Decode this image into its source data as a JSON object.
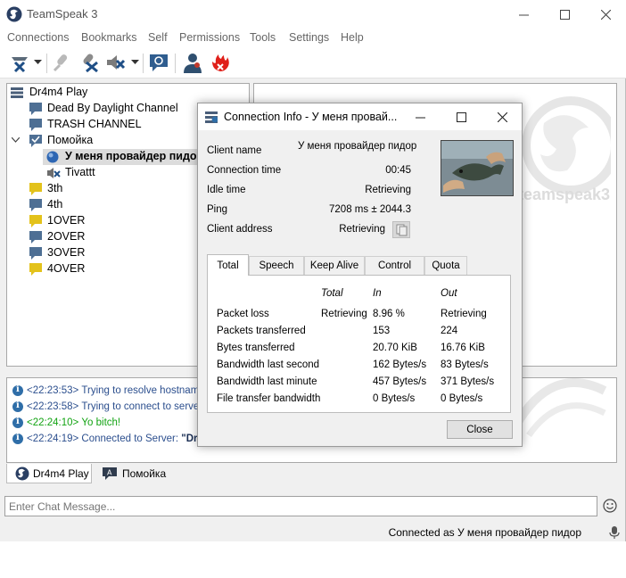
{
  "window": {
    "title": "TeamSpeak 3"
  },
  "menu": [
    "Connections",
    "Bookmarks",
    "Self",
    "Permissions",
    "Tools",
    "Settings",
    "Help"
  ],
  "toolbar_icons": [
    "disconnect-icon",
    "chevron-down-icon",
    "toggle-microphone-icon",
    "toggle-speakers-icon",
    "away-icon",
    "chevron-down-icon",
    "whisper-icon",
    "contacts-icon",
    "ban-icon"
  ],
  "tree": {
    "server": "Dr4m4 Play",
    "rows": [
      {
        "label": "Dead By Daylight Channel",
        "bold": false
      },
      {
        "label": "TRASH CHANNEL",
        "bold": false
      },
      {
        "label": "Помойка",
        "bold": false
      },
      {
        "label": "У меня провайдер пидор",
        "bold": true
      },
      {
        "label": "Tivattt",
        "bold": false
      },
      {
        "label": "3th",
        "bold": false
      },
      {
        "label": "4th",
        "bold": false
      },
      {
        "label": "1OVER",
        "bold": false
      },
      {
        "label": "2OVER",
        "bold": false
      },
      {
        "label": "3OVER",
        "bold": false
      },
      {
        "label": "4OVER",
        "bold": false
      }
    ]
  },
  "info_watermark": "teamspeak3",
  "log": [
    {
      "time": "<22:23:53>",
      "text": "Trying to resolve hostname",
      "color": "#2c4f8e"
    },
    {
      "time": "<22:23:58>",
      "text": "Trying to connect to server",
      "color": "#2c4f8e"
    },
    {
      "time": "<22:24:10>",
      "text": "Yo bitch!",
      "color": "#12a312"
    },
    {
      "time": "<22:24:19>",
      "text": "Connected to Server:",
      "extra": "\"Dr4",
      "color": "#2c4f8e"
    }
  ],
  "chat_tabs": [
    "Dr4m4 Play",
    "Помойка"
  ],
  "chat_input": {
    "placeholder": "Enter Chat Message..."
  },
  "status": {
    "text": "Connected as У меня провайдер пидор"
  },
  "dialog": {
    "title": "Connection Info - У меня провай...",
    "fields": [
      {
        "label": "Client name",
        "value": "У меня провайдер пидор"
      },
      {
        "label": "Connection time",
        "value": "00:45"
      },
      {
        "label": "Idle time",
        "value": "Retrieving"
      },
      {
        "label": "Ping",
        "value": "7208 ms ± 2044.3"
      },
      {
        "label": "Client address",
        "value": "Retrieving"
      }
    ],
    "tabs": [
      "Total",
      "Speech",
      "Keep Alive",
      "Control",
      "Quota"
    ],
    "active_tab": "Total",
    "table": {
      "headers": [
        "Total",
        "In",
        "Out"
      ],
      "rows": [
        {
          "label": "Packet loss",
          "total": "Retrieving",
          "in": "8.96 %",
          "out": "Retrieving"
        },
        {
          "label": "Packets transferred",
          "total": "",
          "in": "153",
          "out": "224"
        },
        {
          "label": "Bytes transferred",
          "total": "",
          "in": "20.70 KiB",
          "out": "16.76 KiB"
        },
        {
          "label": "Bandwidth last second",
          "total": "",
          "in": "162 Bytes/s",
          "out": "83 Bytes/s"
        },
        {
          "label": "Bandwidth last minute",
          "total": "",
          "in": "457 Bytes/s",
          "out": "371 Bytes/s"
        },
        {
          "label": "File transfer bandwidth",
          "total": "",
          "in": "0 Bytes/s",
          "out": "0 Bytes/s"
        }
      ]
    },
    "close_label": "Close"
  }
}
